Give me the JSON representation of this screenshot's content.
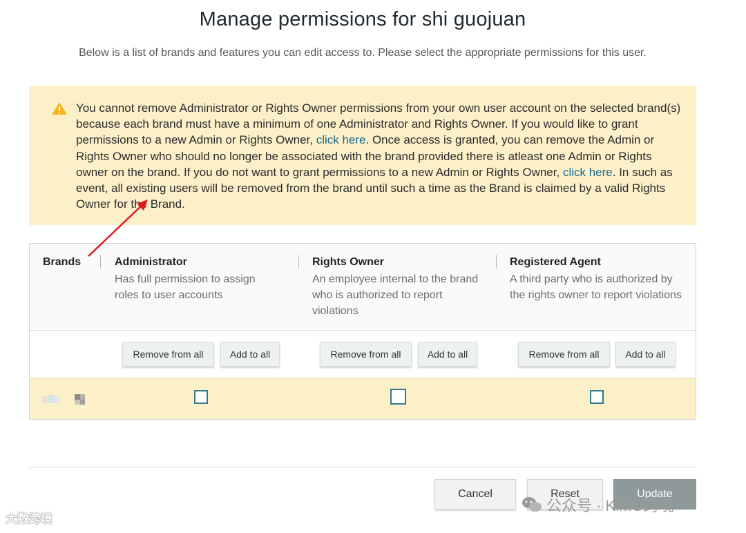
{
  "header": {
    "title": "Manage permissions for shi guojuan",
    "subtitle": "Below is a list of brands and features you can edit access to. Please select the appropriate permissions for this user."
  },
  "alert": {
    "icon": "warning-icon",
    "color": "#fcf0c9",
    "text_1": "You cannot remove Administrator or Rights Owner permissions from your own user account on the selected brand(s) because each brand must have a minimum of one Administrator and Rights Owner. If you would like to grant permissions to a new Admin or Rights Owner, ",
    "link_1": "click here",
    "text_2": ". Once access is granted, you can remove the Admin or Rights Owner who should no longer be associated with the brand provided there is atleast one Admin or Rights owner on the brand. If you do not want to grant permissions to a new Admin or Rights Owner, ",
    "link_2": "click here",
    "text_3": ". In such as event, all existing users will be removed from the brand until such a time as the Brand is claimed by a valid Rights Owner for the Brand."
  },
  "table": {
    "brands_header": "Brands",
    "columns": [
      {
        "title": "Administrator",
        "description": "Has full permission to assign roles to user accounts",
        "remove_label": "Remove from all",
        "add_label": "Add to all",
        "checked": false
      },
      {
        "title": "Rights Owner",
        "description": "An employee internal to the brand who is authorized to report violations",
        "remove_label": "Remove from all",
        "add_label": "Add to all",
        "checked": false
      },
      {
        "title": "Registered Agent",
        "description": "A third party who is authorized by the rights owner to report violations",
        "remove_label": "Remove from all",
        "add_label": "Add to all",
        "checked": false
      }
    ]
  },
  "footer": {
    "cancel_label": "Cancel",
    "reset_label": "Reset",
    "update_label": "Update"
  },
  "watermarks": {
    "left": "大数跨境",
    "right": "公众号 · KiMO跨境"
  }
}
